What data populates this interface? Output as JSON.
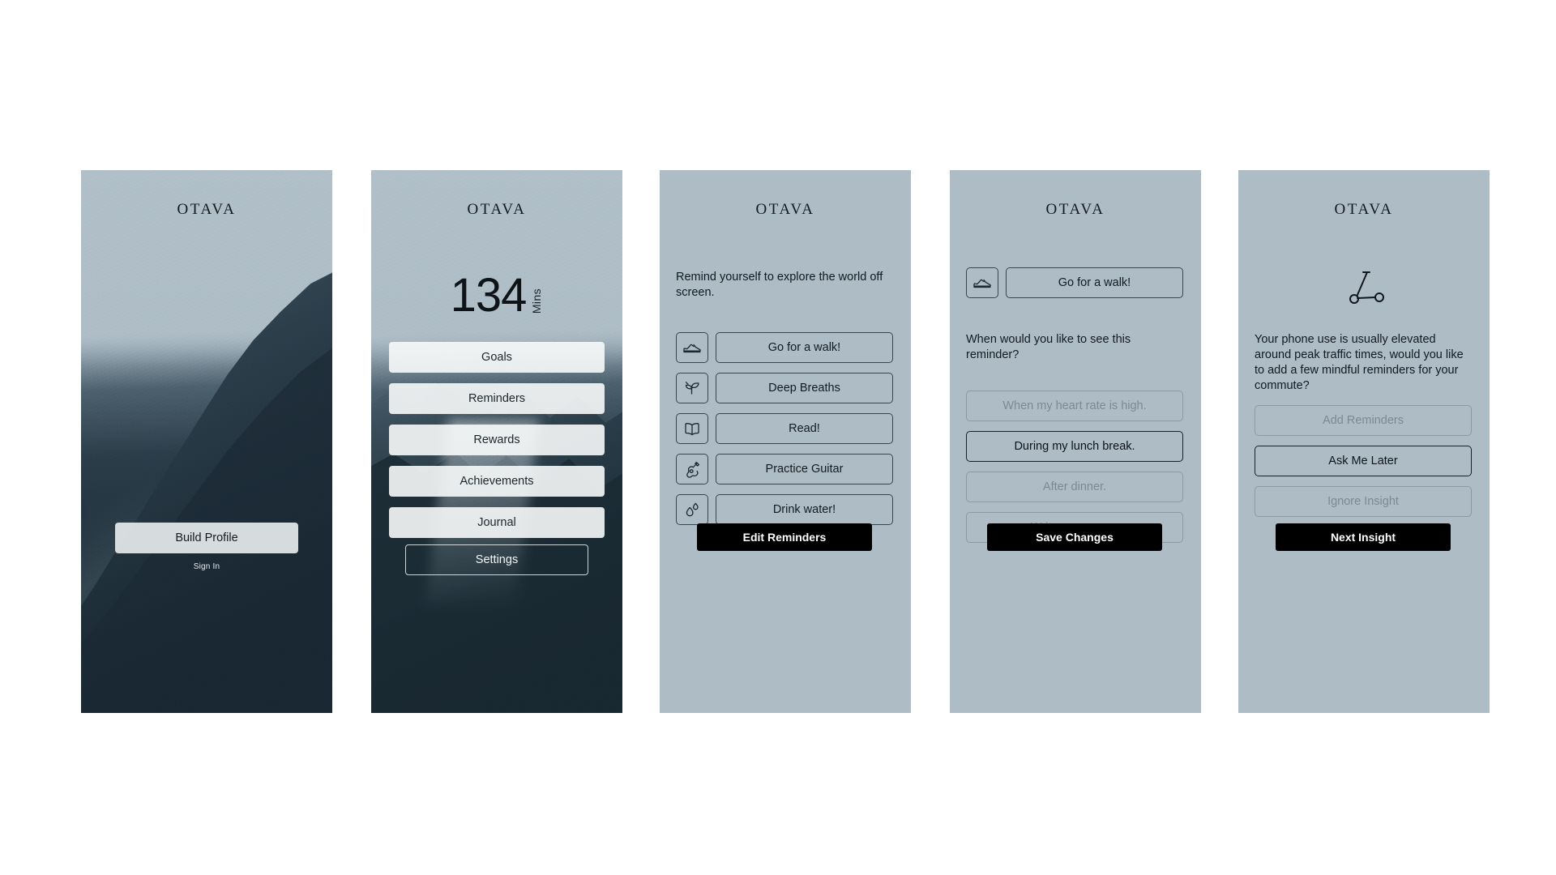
{
  "brand": {
    "name": "OTAVA"
  },
  "colors": {
    "screen_bg": "#adbcc5",
    "ink": "#0c1419",
    "muted": "#7b8a95",
    "border_active": "#16222a",
    "border_muted": "#8b9aa4",
    "cta_bg": "#000000",
    "cta_text": "#ffffff",
    "glass_btn": "#f7f9fa"
  },
  "screens": [
    {
      "id": "welcome",
      "brand": "OTAVA",
      "primary_cta": "Build Profile",
      "secondary_link": "Sign In"
    },
    {
      "id": "dashboard",
      "brand": "OTAVA",
      "counter": {
        "value": "134",
        "unit": "Mins"
      },
      "menu": [
        {
          "label": "Goals"
        },
        {
          "label": "Reminders"
        },
        {
          "label": "Rewards"
        },
        {
          "label": "Achievements"
        },
        {
          "label": "Journal"
        }
      ],
      "settings_button": "Settings"
    },
    {
      "id": "reminders",
      "brand": "OTAVA",
      "prompt": "Remind yourself to explore the world off screen.",
      "items": [
        {
          "icon": "shoe-icon",
          "label": "Go for a walk!"
        },
        {
          "icon": "leaf-icon",
          "label": "Deep Breaths"
        },
        {
          "icon": "book-icon",
          "label": "Read!"
        },
        {
          "icon": "guitar-icon",
          "label": "Practice Guitar"
        },
        {
          "icon": "water-drop-icon",
          "label": "Drink water!"
        }
      ],
      "cta": "Edit Reminders"
    },
    {
      "id": "reminder-schedule",
      "brand": "OTAVA",
      "selected_reminder": {
        "icon": "shoe-icon",
        "label": "Go for a walk!"
      },
      "prompt": "When would you like to see this reminder?",
      "options": [
        {
          "label": "When my heart rate is high.",
          "state": "muted"
        },
        {
          "label": "During my lunch break.",
          "state": "active"
        },
        {
          "label": "After dinner.",
          "state": "muted"
        },
        {
          "label": "Write your own...",
          "state": "muted"
        }
      ],
      "cta": "Save Changes"
    },
    {
      "id": "insight",
      "brand": "OTAVA",
      "hero_icon": "scooter-icon",
      "prompt": "Your phone use is usually elevated around peak traffic times, would you like to add a few mindful reminders for your commute?",
      "options": [
        {
          "label": "Add Reminders",
          "state": "muted"
        },
        {
          "label": "Ask Me Later",
          "state": "active"
        },
        {
          "label": "Ignore Insight",
          "state": "muted"
        }
      ],
      "cta": "Next Insight"
    }
  ]
}
